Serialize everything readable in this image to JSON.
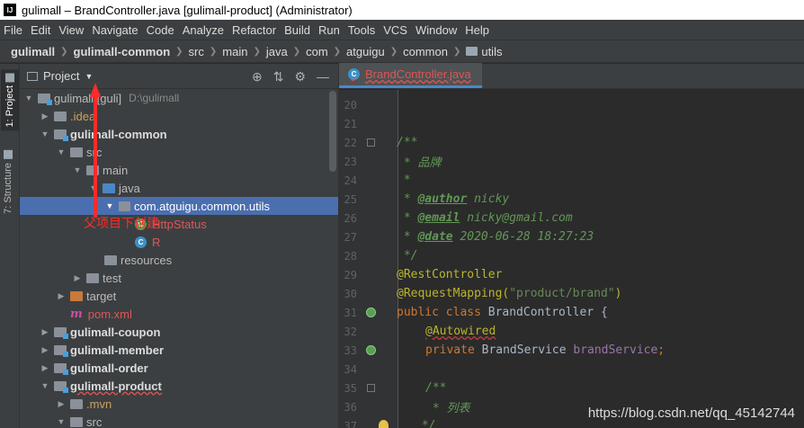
{
  "window": {
    "title": "gulimall – BrandController.java [gulimall-product] (Administrator)",
    "logo": "IJ"
  },
  "menu": [
    "File",
    "Edit",
    "View",
    "Navigate",
    "Code",
    "Analyze",
    "Refactor",
    "Build",
    "Run",
    "Tools",
    "VCS",
    "Window",
    "Help"
  ],
  "breadcrumb": [
    "gulimall",
    "gulimall-common",
    "src",
    "main",
    "java",
    "com",
    "atguigu",
    "common",
    "utils"
  ],
  "stripe": {
    "project_tab": "1: Project",
    "structure_tab": "7: Structure"
  },
  "project_panel": {
    "title": "Project",
    "tree": [
      {
        "label": "gulimall [guli]",
        "hint": "D:\\gulimall",
        "expanded": true
      },
      {
        "label": ".idea",
        "expanded": false
      },
      {
        "label": "gulimall-common",
        "expanded": true
      },
      {
        "label": "src",
        "expanded": true
      },
      {
        "label": "main",
        "expanded": true
      },
      {
        "label": "java",
        "expanded": false
      },
      {
        "label": "com.atguigu.common.utils",
        "expanded": true,
        "selected": true
      },
      {
        "label": "HttpStatus"
      },
      {
        "label": "R"
      },
      {
        "label": "resources"
      },
      {
        "label": "test",
        "expanded": false
      },
      {
        "label": "target",
        "expanded": false
      },
      {
        "label": "pom.xml"
      },
      {
        "label": "gulimall-coupon",
        "expanded": false
      },
      {
        "label": "gulimall-member",
        "expanded": false
      },
      {
        "label": "gulimall-order",
        "expanded": false
      },
      {
        "label": "gulimall-product",
        "expanded": true
      },
      {
        "label": ".mvn",
        "expanded": false
      },
      {
        "label": "src",
        "expanded": false
      }
    ]
  },
  "annotation": {
    "text": "父项目下创建"
  },
  "editor": {
    "tab_label": "BrandController.java",
    "lines": [
      {
        "n": "20"
      },
      {
        "n": "21"
      },
      {
        "n": "22",
        "text": "/**"
      },
      {
        "n": "23",
        "text": " * 品牌"
      },
      {
        "n": "24",
        "text": " *"
      },
      {
        "n": "25",
        "tag": "@author",
        "text": " nicky"
      },
      {
        "n": "26",
        "tag": "@email",
        "text": " nicky@gmail.com"
      },
      {
        "n": "27",
        "tag": "@date",
        "text": " 2020-06-28 18:27:23"
      },
      {
        "n": "28",
        "text": " */"
      },
      {
        "n": "29",
        "text": "@RestController"
      },
      {
        "n": "30",
        "text": "@RequestMapping(",
        "str": "\"product/brand\"",
        "text2": ")"
      },
      {
        "n": "31",
        "kw": "public class ",
        "text": "BrandController {"
      },
      {
        "n": "32",
        "text": "@Autowired"
      },
      {
        "n": "33",
        "kw": "private ",
        "text": "BrandService ",
        "fld": "brandService",
        "text2": ";"
      },
      {
        "n": "34"
      },
      {
        "n": "35",
        "text": "/**"
      },
      {
        "n": "36",
        "text": " * 列表"
      },
      {
        "n": "37",
        "text": " */"
      }
    ]
  },
  "watermark": "https://blog.csdn.net/qq_45142744"
}
